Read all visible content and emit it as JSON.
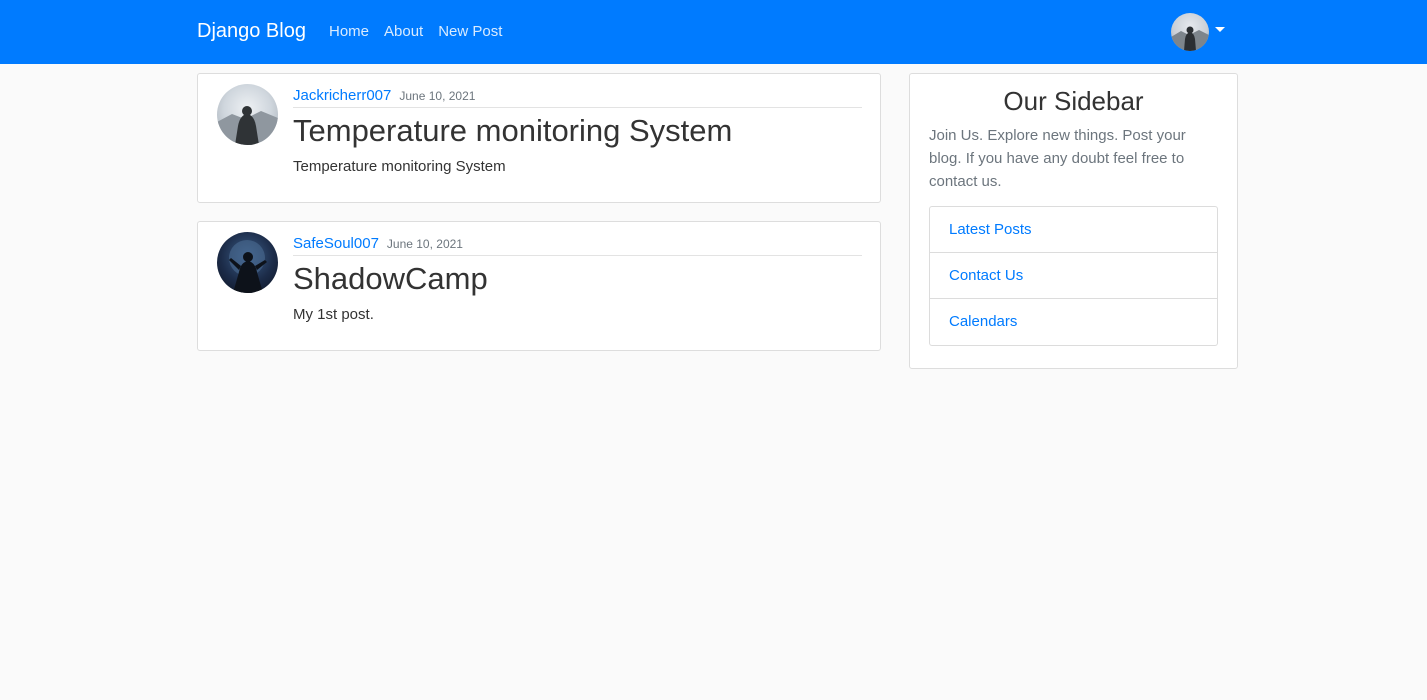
{
  "navbar": {
    "brand": "Django Blog",
    "links": [
      "Home",
      "About",
      "New Post"
    ],
    "user_avatar_icon": "user-avatar-icon",
    "dropdown_icon": "caret-down-icon"
  },
  "posts": [
    {
      "author": "Jackricherr007",
      "date": "June 10, 2021",
      "title": "Temperature monitoring System",
      "content": "Temperature monitoring System"
    },
    {
      "author": "SafeSoul007",
      "date": "June 10, 2021",
      "title": "ShadowCamp",
      "content": "My 1st post."
    }
  ],
  "sidebar": {
    "title": "Our Sidebar",
    "description": "Join Us. Explore new things. Post your blog. If you have any doubt feel free to contact us.",
    "items": [
      "Latest Posts",
      "Contact Us",
      "Calendars"
    ]
  },
  "colors": {
    "primary": "#007bff",
    "background": "#fafafa"
  }
}
